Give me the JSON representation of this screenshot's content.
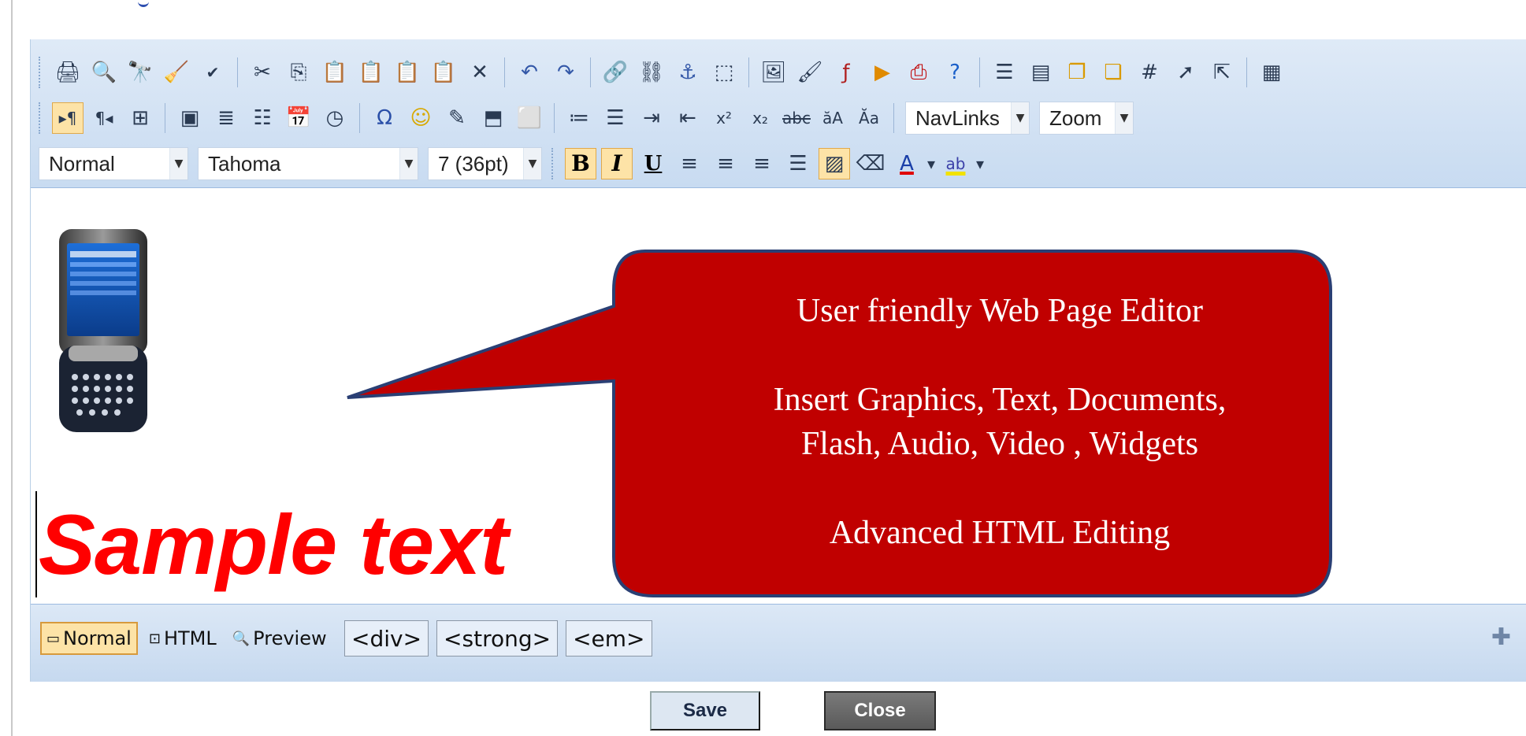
{
  "toolbar": {
    "row1_icons": [
      "print-icon",
      "preview-icon",
      "find-icon",
      "clean-icon",
      "spellcheck-icon",
      "cut-icon",
      "copy-icon",
      "paste-icon",
      "paste-text-icon",
      "paste-word-icon",
      "paste-html-icon",
      "delete-icon",
      "undo-icon",
      "redo-icon",
      "link-icon",
      "unlink-icon",
      "anchor-icon",
      "select-icon",
      "image-icon",
      "edit-image-icon",
      "flash-icon",
      "media-icon",
      "pdf-icon",
      "help-icon",
      "horizontal-rule-icon",
      "template-icon",
      "layer-icon",
      "layer-copy-icon",
      "table-icon",
      "pointer-plus-icon",
      "pointer-select-icon",
      "table-props-icon"
    ],
    "row2_icons": [
      "ltr-icon",
      "rtl-icon",
      "block-icon",
      "form-icon",
      "list-box-icon",
      "textarea-icon",
      "date-icon",
      "clock-icon",
      "omega-icon",
      "smiley-icon",
      "snippet-icon",
      "frame-icon",
      "markup-icon",
      "ordered-list-icon",
      "unordered-list-icon",
      "indent-icon",
      "outdent-icon",
      "superscript-icon",
      "subscript-icon",
      "strikethrough-icon",
      "uppercase-icon",
      "lowercase-icon"
    ],
    "navlinks": "NavLinks",
    "zoom": "Zoom",
    "paragraph_style": "Normal",
    "font_name": "Tahoma",
    "font_size": "7 (36pt)",
    "bold": "B",
    "italic": "I",
    "underline": "U"
  },
  "content": {
    "sample_text": "Sample text",
    "callout_line1": "User friendly Web Page Editor",
    "callout_line2": "Insert  Graphics, Text, Documents,",
    "callout_line3": "Flash, Audio, Video , Widgets",
    "callout_line4": "Advanced HTML Editing",
    "callout_color": "#c00000",
    "sample_text_color": "#ff0000"
  },
  "status": {
    "mode_normal": "Normal",
    "mode_html": "HTML",
    "mode_preview": "Preview",
    "tags": [
      "<div>",
      "<strong>",
      "<em>"
    ]
  },
  "actions": {
    "save": "Save",
    "close": "Close"
  }
}
